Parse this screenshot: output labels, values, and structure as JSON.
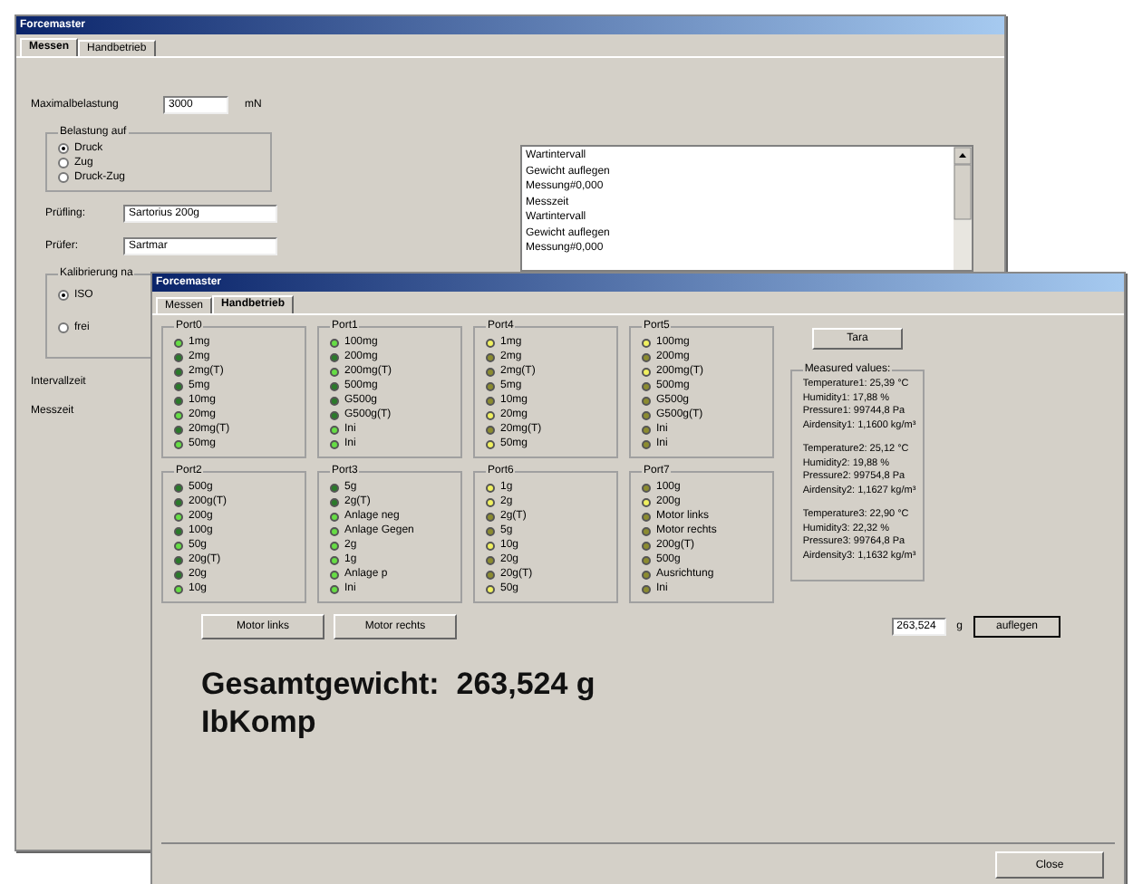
{
  "back_window": {
    "title": "Forcemaster",
    "tabs": [
      {
        "label": "Messen",
        "selected": true
      },
      {
        "label": "Handbetrieb",
        "selected": false
      }
    ],
    "max_load": {
      "label": "Maximalbelastung",
      "value": "3000",
      "unit": "mN"
    },
    "load_group": {
      "title": "Belastung auf",
      "options": [
        {
          "label": "Druck",
          "selected": true
        },
        {
          "label": "Zug",
          "selected": false
        },
        {
          "label": "Druck-Zug",
          "selected": false
        }
      ]
    },
    "fields": [
      {
        "label": "Prüfling:",
        "value": "Sartorius 200g"
      },
      {
        "label": "Prüfer:",
        "value": "Sartmar"
      }
    ],
    "calibration_group": {
      "title": "Kalibrierung na",
      "options": [
        {
          "label": "ISO",
          "selected": true
        },
        {
          "label": "frei",
          "selected": false
        }
      ]
    },
    "labels": [
      "Intervallzeit",
      "Messzeit"
    ],
    "log": [
      "Wartintervall",
      "Gewicht auflegen",
      "Messung#0,000",
      "Messzeit",
      "Wartintervall",
      "Gewicht auflegen",
      "Messung#0,000"
    ]
  },
  "front_window": {
    "title": "Forcemaster",
    "tabs": [
      {
        "label": "Messen",
        "selected": false
      },
      {
        "label": "Handbetrieb",
        "selected": true
      }
    ],
    "ports": [
      {
        "title": "Port0",
        "items": [
          {
            "label": "1mg",
            "color": "#66dd44"
          },
          {
            "label": "2mg",
            "color": "#2a7a2a"
          },
          {
            "label": "2mg(T)",
            "color": "#2a7a2a"
          },
          {
            "label": "5mg",
            "color": "#2a7a2a"
          },
          {
            "label": "10mg",
            "color": "#2a7a2a"
          },
          {
            "label": "20mg",
            "color": "#66dd44"
          },
          {
            "label": "20mg(T)",
            "color": "#2a7a2a"
          },
          {
            "label": "50mg",
            "color": "#66dd44"
          }
        ]
      },
      {
        "title": "Port1",
        "items": [
          {
            "label": "100mg",
            "color": "#66dd44"
          },
          {
            "label": "200mg",
            "color": "#2a7a2a"
          },
          {
            "label": "200mg(T)",
            "color": "#66dd44"
          },
          {
            "label": "500mg",
            "color": "#2a7a2a"
          },
          {
            "label": "G500g",
            "color": "#2a7a2a"
          },
          {
            "label": "G500g(T)",
            "color": "#2a7a2a"
          },
          {
            "label": "Ini",
            "color": "#66dd44"
          },
          {
            "label": "Ini",
            "color": "#66dd44"
          }
        ]
      },
      {
        "title": "Port4",
        "items": [
          {
            "label": "1mg",
            "color": "#f0f060"
          },
          {
            "label": "2mg",
            "color": "#8c8c30"
          },
          {
            "label": "2mg(T)",
            "color": "#8c8c30"
          },
          {
            "label": "5mg",
            "color": "#8c8c30"
          },
          {
            "label": "10mg",
            "color": "#8c8c30"
          },
          {
            "label": "20mg",
            "color": "#f0f060"
          },
          {
            "label": "20mg(T)",
            "color": "#8c8c30"
          },
          {
            "label": "50mg",
            "color": "#f0f060"
          }
        ]
      },
      {
        "title": "Port5",
        "items": [
          {
            "label": "100mg",
            "color": "#f0f060"
          },
          {
            "label": "200mg",
            "color": "#8c8c30"
          },
          {
            "label": "200mg(T)",
            "color": "#f0f060"
          },
          {
            "label": "500mg",
            "color": "#8c8c30"
          },
          {
            "label": "G500g",
            "color": "#8c8c30"
          },
          {
            "label": "G500g(T)",
            "color": "#8c8c30"
          },
          {
            "label": "Ini",
            "color": "#8c8c30"
          },
          {
            "label": "Ini",
            "color": "#8c8c30"
          }
        ]
      },
      {
        "title": "Port2",
        "items": [
          {
            "label": "500g",
            "color": "#2a7a2a"
          },
          {
            "label": "200g(T)",
            "color": "#2a7a2a"
          },
          {
            "label": "200g",
            "color": "#66dd44"
          },
          {
            "label": "100g",
            "color": "#2a7a2a"
          },
          {
            "label": "50g",
            "color": "#66dd44"
          },
          {
            "label": "20g(T)",
            "color": "#2a7a2a"
          },
          {
            "label": "20g",
            "color": "#2a7a2a"
          },
          {
            "label": "10g",
            "color": "#66dd44"
          }
        ]
      },
      {
        "title": "Port3",
        "items": [
          {
            "label": "5g",
            "color": "#2a7a2a"
          },
          {
            "label": "2g(T)",
            "color": "#2a7a2a"
          },
          {
            "label": "Anlage neg",
            "color": "#66dd44"
          },
          {
            "label": "Anlage Gegen",
            "color": "#66dd44"
          },
          {
            "label": "2g",
            "color": "#66dd44"
          },
          {
            "label": "1g",
            "color": "#66dd44"
          },
          {
            "label": "Anlage p",
            "color": "#66dd44"
          },
          {
            "label": "Ini",
            "color": "#66dd44"
          }
        ]
      },
      {
        "title": "Port6",
        "items": [
          {
            "label": "1g",
            "color": "#f0f060"
          },
          {
            "label": "2g",
            "color": "#f0f060"
          },
          {
            "label": "2g(T)",
            "color": "#8c8c30"
          },
          {
            "label": "5g",
            "color": "#8c8c30"
          },
          {
            "label": "10g",
            "color": "#f0f060"
          },
          {
            "label": "20g",
            "color": "#8c8c30"
          },
          {
            "label": "20g(T)",
            "color": "#8c8c30"
          },
          {
            "label": "50g",
            "color": "#f0f060"
          }
        ]
      },
      {
        "title": "Port7",
        "items": [
          {
            "label": "100g",
            "color": "#8c8c30"
          },
          {
            "label": "200g",
            "color": "#f0f060"
          },
          {
            "label": "Motor links",
            "color": "#8c8c30"
          },
          {
            "label": "Motor rechts",
            "color": "#8c8c30"
          },
          {
            "label": "200g(T)",
            "color": "#8c8c30"
          },
          {
            "label": "500g",
            "color": "#8c8c30"
          },
          {
            "label": "Ausrichtung",
            "color": "#8c8c30"
          },
          {
            "label": "Ini",
            "color": "#8c8c30"
          }
        ]
      }
    ],
    "tare_button": "Tara",
    "measured": {
      "title": "Measured values:",
      "blocks": [
        [
          "Temperature1: 25,39 °C",
          "Humidity1: 17,88 %",
          "Pressure1: 99744,8 Pa",
          "Airdensity1: 1,1600 kg/m³"
        ],
        [
          "Temperature2: 25,12 °C",
          "Humidity2: 19,88 %",
          "Pressure2: 99754,8 Pa",
          "Airdensity2: 1,1627 kg/m³"
        ],
        [
          "Temperature3: 22,90 °C",
          "Humidity3: 22,32 %",
          "Pressure3: 99764,8 Pa",
          "Airdensity3: 1,1632 kg/m³"
        ]
      ]
    },
    "weight_input": {
      "value": "263,524",
      "unit": "g",
      "button": "auflegen"
    },
    "motor_buttons": [
      "Motor links",
      "Motor rechts"
    ],
    "total": "Gesamtgewicht:  263,524 g",
    "status": "IbKomp",
    "close_button": "Close"
  }
}
